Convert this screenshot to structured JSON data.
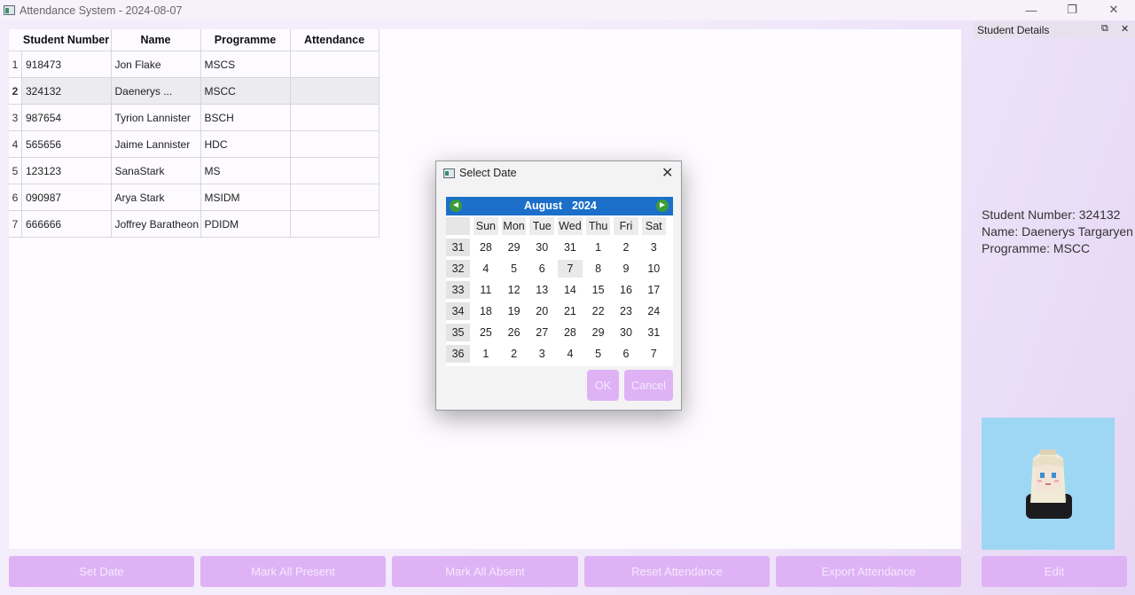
{
  "window": {
    "title": "Attendance System - 2024-08-07",
    "minimize": "—",
    "restore": "❐",
    "close": "✕"
  },
  "table": {
    "headers": [
      "Student Number",
      "Name",
      "Programme",
      "Attendance"
    ],
    "rows": [
      {
        "num": "1",
        "student_number": "918473",
        "name": "Jon Flake",
        "programme": "MSCS",
        "attendance": ""
      },
      {
        "num": "2",
        "student_number": "324132",
        "name": "Daenerys ...",
        "programme": "MSCC",
        "attendance": ""
      },
      {
        "num": "3",
        "student_number": "987654",
        "name": "Tyrion Lannister",
        "programme": "BSCH",
        "attendance": ""
      },
      {
        "num": "4",
        "student_number": "565656",
        "name": "Jaime Lannister",
        "programme": "HDC",
        "attendance": ""
      },
      {
        "num": "5",
        "student_number": "123123",
        "name": "SanaStark",
        "programme": "MS",
        "attendance": ""
      },
      {
        "num": "6",
        "student_number": "090987",
        "name": "Arya Stark",
        "programme": "MSIDM",
        "attendance": ""
      },
      {
        "num": "7",
        "student_number": "666666",
        "name": "Joffrey Baratheon",
        "programme": "PDIDM",
        "attendance": ""
      }
    ]
  },
  "dock": {
    "title": "Student Details",
    "float_icon": "⧉",
    "close_icon": "✕",
    "student_number": "Student Number: 324132",
    "name": "Name: Daenerys Targaryen",
    "programme": "Programme: MSCC",
    "edit_label": "Edit"
  },
  "buttons": {
    "set_date": "Set Date",
    "mark_all_present": "Mark All Present",
    "mark_all_absent": "Mark All Absent",
    "reset_attendance": "Reset Attendance",
    "export_attendance": "Export Attendance"
  },
  "dialog": {
    "title": "Select Date",
    "close": "✕",
    "month": "August",
    "year": "2024",
    "prev": "◄",
    "next": "►",
    "weekdays": [
      "Sun",
      "Mon",
      "Tue",
      "Wed",
      "Thu",
      "Fri",
      "Sat"
    ],
    "weeks": [
      {
        "week": "31",
        "days": [
          "28",
          "29",
          "30",
          "31",
          "1",
          "2",
          "3"
        ]
      },
      {
        "week": "32",
        "days": [
          "4",
          "5",
          "6",
          "7",
          "8",
          "9",
          "10"
        ]
      },
      {
        "week": "33",
        "days": [
          "11",
          "12",
          "13",
          "14",
          "15",
          "16",
          "17"
        ]
      },
      {
        "week": "34",
        "days": [
          "18",
          "19",
          "20",
          "21",
          "22",
          "23",
          "24"
        ]
      },
      {
        "week": "35",
        "days": [
          "25",
          "26",
          "27",
          "28",
          "29",
          "30",
          "31"
        ]
      },
      {
        "week": "36",
        "days": [
          "1",
          "2",
          "3",
          "4",
          "5",
          "6",
          "7"
        ]
      }
    ],
    "ok_label": "OK",
    "cancel_label": "Cancel"
  },
  "colors": {
    "button_bg": "#dfb2f6",
    "calendar_header": "#1b6fc9",
    "nav_arrow": "#3a9d3a",
    "photo_bg": "#9ed7f3"
  }
}
